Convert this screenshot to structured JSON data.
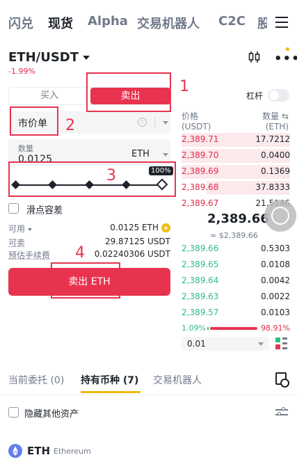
{
  "nav": {
    "tabs": [
      {
        "label": "闪兑",
        "active": false
      },
      {
        "label": "现货",
        "active": true
      },
      {
        "label": "Alpha",
        "active": false
      },
      {
        "label": "交易机器人",
        "active": false
      },
      {
        "label": "C2C",
        "active": false
      },
      {
        "label": "股",
        "active": false
      }
    ],
    "menu_icon": "hamburger-icon"
  },
  "pair": {
    "symbol": "ETH/USDT",
    "change": "-1.99%",
    "chart_icon": "candlestick-icon",
    "more_icon": "more-icon",
    "more_glyph": "•••"
  },
  "order_form": {
    "buy_label": "买入",
    "sell_label": "卖出",
    "order_type": "市价单",
    "info_glyph": "i",
    "quantity_label": "数量",
    "quantity_value": "0.0125",
    "quantity_unit": "ETH",
    "slider_percent": 100,
    "slider_badge": "100%",
    "slippage_label": "滑点容差",
    "available_label": "可用",
    "available_value": "0.0125 ETH",
    "plus_glyph": "+",
    "sellable_label": "可卖",
    "sellable_value": "29.87125 USDT",
    "fee_label": "预估手续费",
    "fee_value": "0.02240306 USDT",
    "submit_label": "卖出 ETH"
  },
  "leverage": {
    "label": "杠杆",
    "enabled": false
  },
  "annotations": [
    "1",
    "2",
    "3",
    "4"
  ],
  "order_book": {
    "price_header": "价格",
    "price_unit": "(USDT)",
    "qty_header": "数量",
    "qty_unit": "(ETH)",
    "swap_glyph": "⇆",
    "asks": [
      {
        "price": "2,389.71",
        "qty": "17.7212",
        "depth": 1.0
      },
      {
        "price": "2,389.70",
        "qty": "0.0400",
        "depth": 1.0
      },
      {
        "price": "2,389.69",
        "qty": "0.1369",
        "depth": 1.0
      },
      {
        "price": "2,389.68",
        "qty": "37.8333",
        "depth": 0.77
      },
      {
        "price": "2,389.67",
        "qty": "21.5146",
        "depth": 0.0
      }
    ],
    "mid_price": "2,389.66",
    "mid_sub": "≈ $2,389.66",
    "bids": [
      {
        "price": "2,389.66",
        "qty": "0.5303"
      },
      {
        "price": "2,389.65",
        "qty": "0.0108"
      },
      {
        "price": "2,389.64",
        "qty": "0.0042"
      },
      {
        "price": "2,389.63",
        "qty": "0.0022"
      },
      {
        "price": "2,389.57",
        "qty": "0.0103"
      }
    ],
    "buy_ratio": "1.09%",
    "sell_ratio": "98.91%",
    "precision": "0.01"
  },
  "bottom": {
    "tabs": [
      {
        "label": "当前委托 (0)",
        "active": false
      },
      {
        "label": "持有币种 (7)",
        "active": true
      },
      {
        "label": "交易机器人",
        "active": false
      }
    ],
    "hide_label": "隐藏其他资产",
    "asset_symbol": "ETH",
    "asset_name": "Ethereum"
  },
  "colors": {
    "sell": "#e8334f",
    "buy": "#2ebd85",
    "accent": "#f0b90b"
  }
}
